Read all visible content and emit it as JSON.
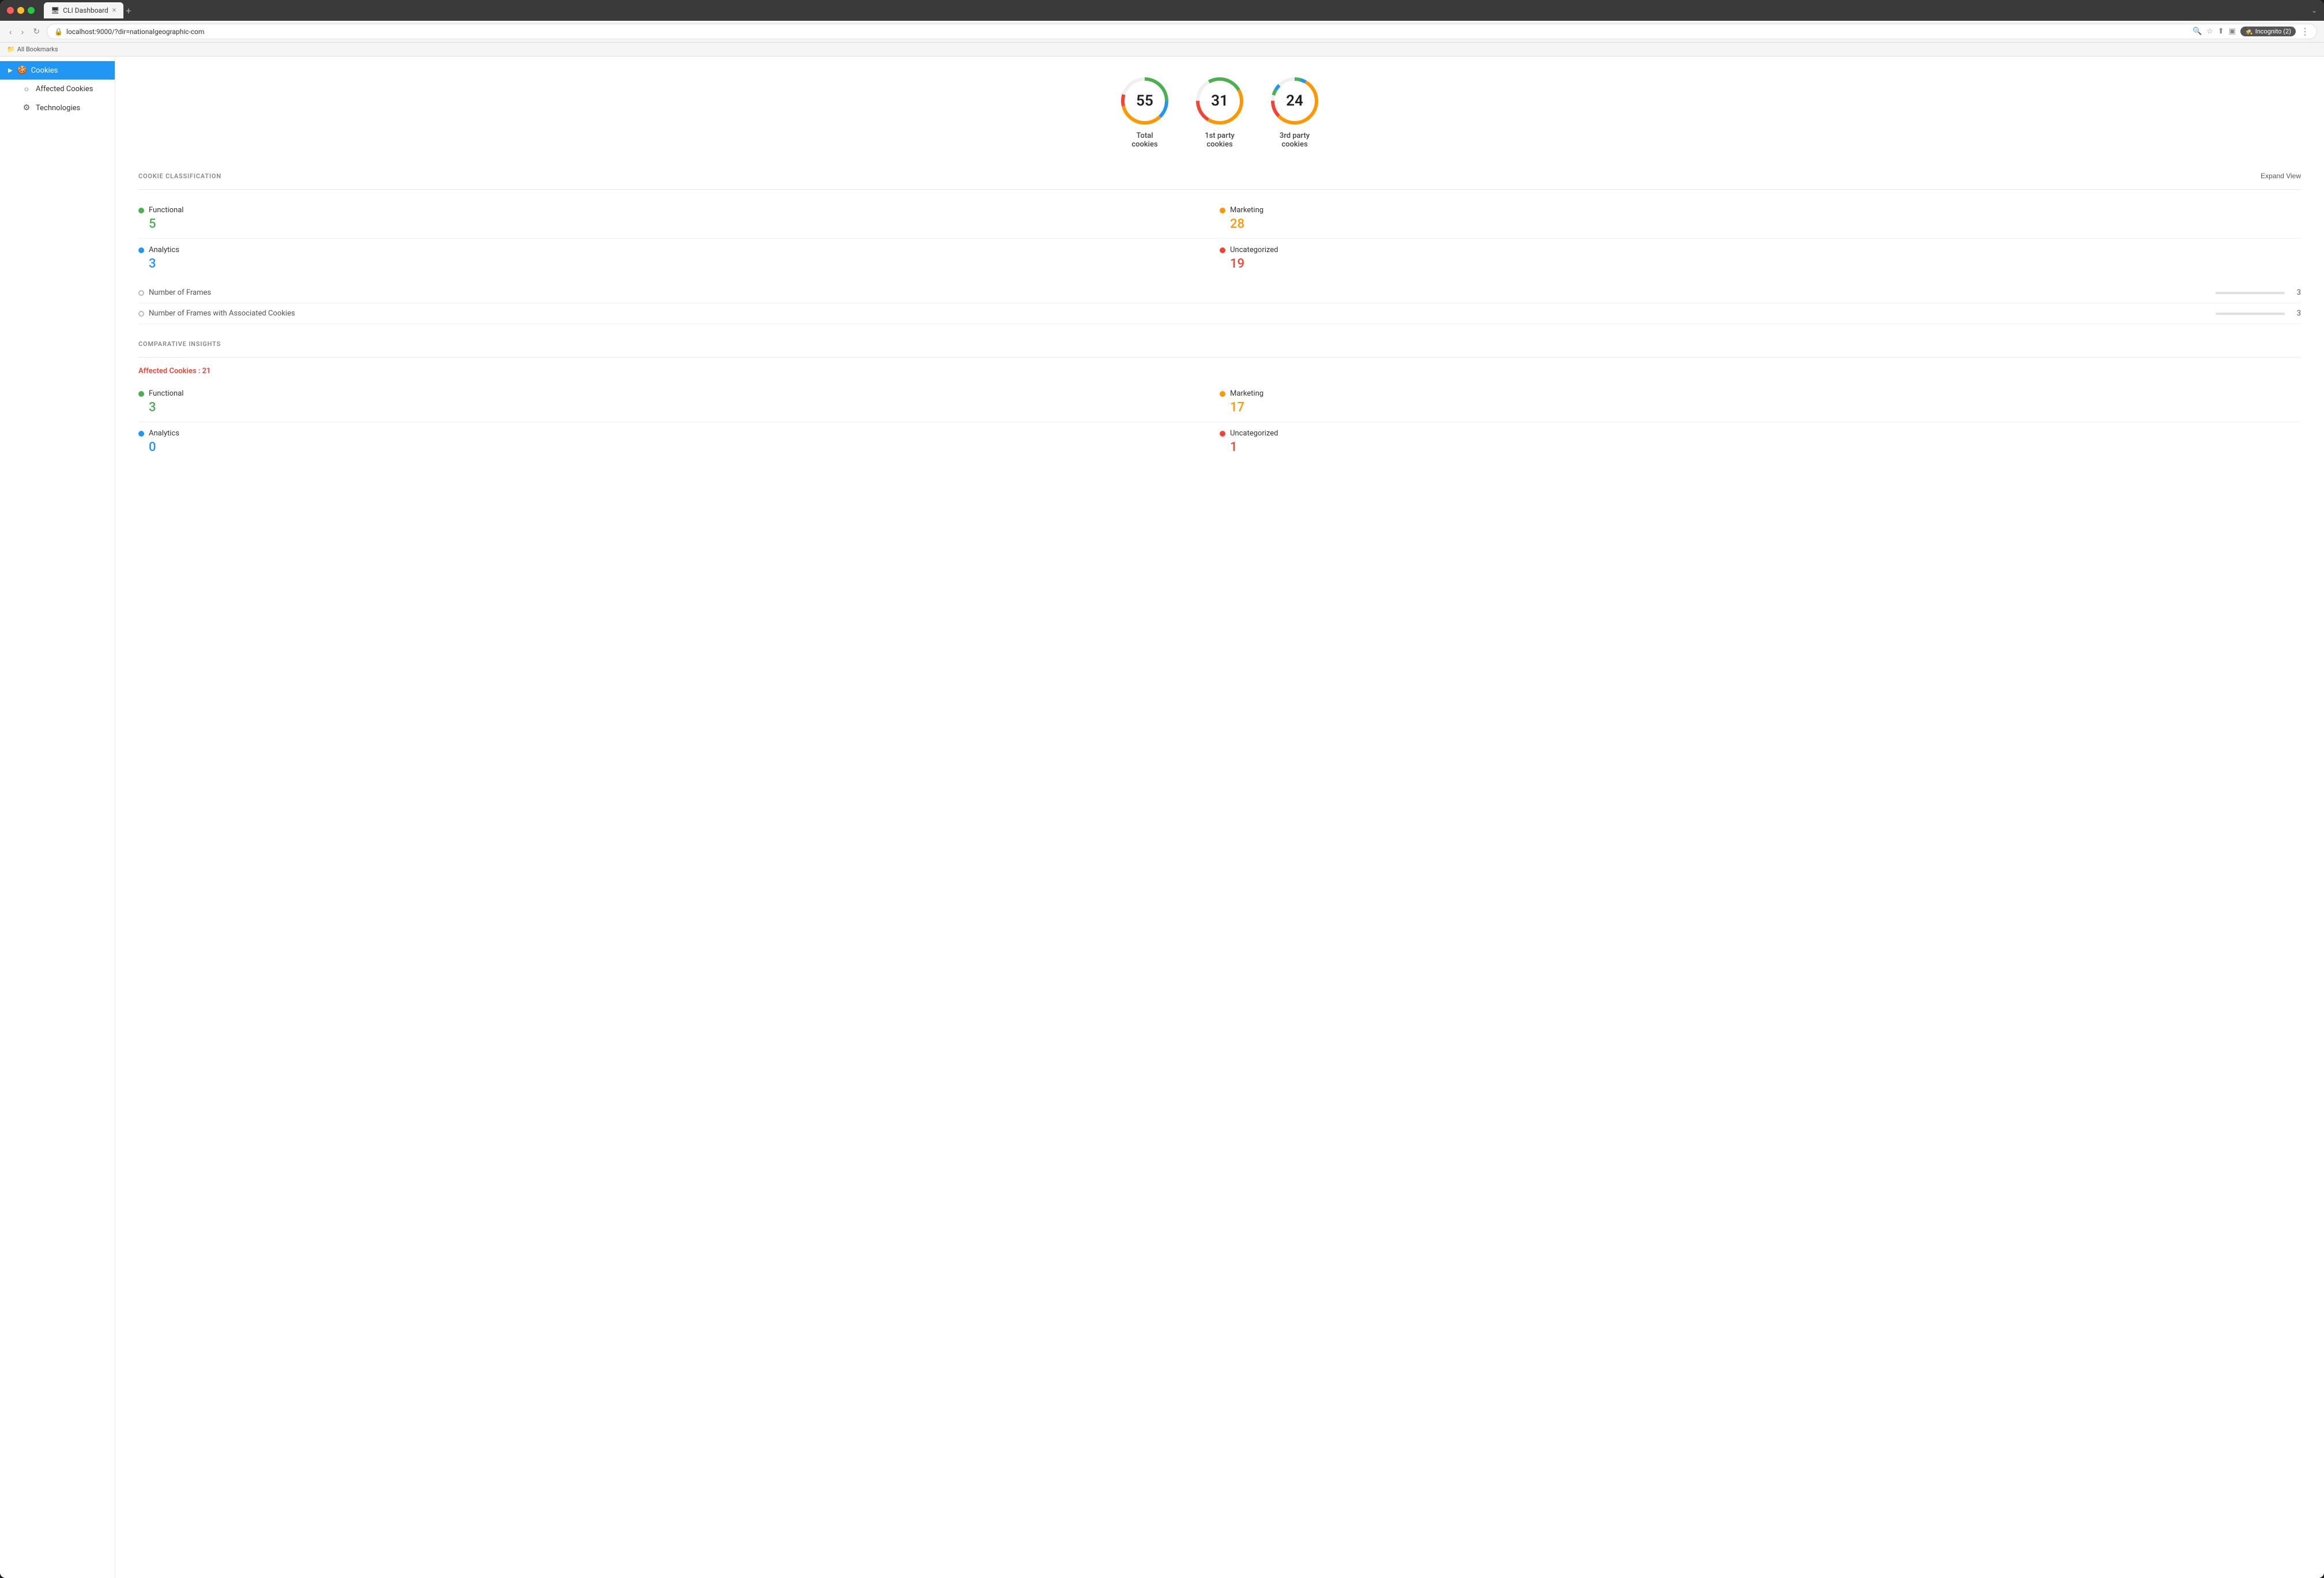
{
  "browser": {
    "tab_title": "CLI Dashboard",
    "url": "localhost:9000/?dir=nationalgeographic-com",
    "incognito_label": "Incognito (2)",
    "bookmarks_label": "All Bookmarks",
    "nav_back": "‹",
    "nav_forward": "›",
    "nav_reload": "↻"
  },
  "sidebar": {
    "items": [
      {
        "id": "cookies",
        "label": "Cookies",
        "icon": "🍪",
        "active": true
      },
      {
        "id": "affected-cookies",
        "label": "Affected Cookies",
        "icon": "○",
        "active": false
      },
      {
        "id": "technologies",
        "label": "Technologies",
        "icon": "⚙",
        "active": false
      }
    ]
  },
  "stats": [
    {
      "id": "total",
      "value": "55",
      "label": "Total\ncookies",
      "label1": "Total",
      "label2": "cookies"
    },
    {
      "id": "first-party",
      "value": "31",
      "label": "1st party\ncookies",
      "label1": "1st party",
      "label2": "cookies"
    },
    {
      "id": "third-party",
      "value": "24",
      "label": "3rd party\ncookies",
      "label1": "3rd party",
      "label2": "cookies"
    }
  ],
  "cookie_classification": {
    "section_title": "COOKIE CLASSIFICATION",
    "expand_label": "Expand View",
    "items": [
      {
        "id": "functional",
        "label": "Functional",
        "count": "5",
        "dot_class": "dot-green",
        "count_class": "count-green"
      },
      {
        "id": "marketing",
        "label": "Marketing",
        "count": "28",
        "dot_class": "dot-orange",
        "count_class": "count-orange"
      },
      {
        "id": "analytics",
        "label": "Analytics",
        "count": "3",
        "dot_class": "dot-blue",
        "count_class": "count-blue"
      },
      {
        "id": "uncategorized",
        "label": "Uncategorized",
        "count": "19",
        "dot_class": "dot-red",
        "count_class": "count-red"
      }
    ],
    "frames": [
      {
        "id": "num-frames",
        "label": "Number of Frames",
        "count": "3"
      },
      {
        "id": "frames-with-cookies",
        "label": "Number of Frames with Associated Cookies",
        "count": "3"
      }
    ]
  },
  "comparative_insights": {
    "section_title": "COMPARATIVE INSIGHTS",
    "affected_label": "Affected Cookies : 21",
    "items": [
      {
        "id": "functional",
        "label": "Functional",
        "count": "3",
        "dot_class": "dot-green",
        "count_class": "count-green"
      },
      {
        "id": "marketing",
        "label": "Marketing",
        "count": "17",
        "dot_class": "dot-orange",
        "count_class": "count-orange"
      },
      {
        "id": "analytics",
        "label": "Analytics",
        "count": "0",
        "dot_class": "dot-blue",
        "count_class": "count-blue"
      },
      {
        "id": "uncategorized",
        "label": "Uncategorized",
        "count": "1",
        "dot_class": "dot-red",
        "count_class": "count-red"
      }
    ]
  }
}
